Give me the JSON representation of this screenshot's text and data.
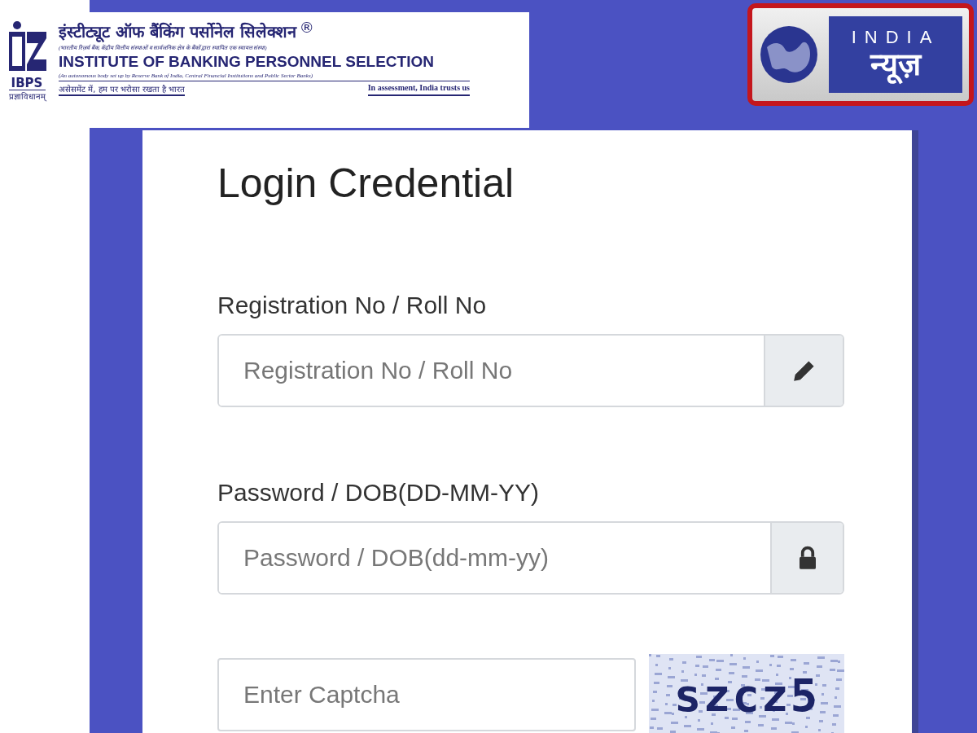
{
  "header": {
    "hindi_title": "इंस्टीट्यूट ऑफ बैंकिंग पर्सोनेल सिलेक्शन",
    "registered_mark": "®",
    "hindi_subtitle": "(भारतीय रिज़र्व बैंक, केंद्रीय वित्तीय संस्थाओं व सार्वजनिक क्षेत्र के बैंकों द्वारा स्थापित एक स्वायत्त संस्था)",
    "english_title": "INSTITUTE OF BANKING PERSONNEL SELECTION",
    "english_subtitle": "(An autonomous body set up by Reserve Bank of India, Central Financial Institutions and Public Sector Banks)",
    "hindi_tagline": "असेसमेंट में, हम पर भरोसा रखता है भारत",
    "english_tagline": "In assessment, India trusts us",
    "logo_text": "IBPS",
    "logo_motto": "प्रज्ञाविधानम्"
  },
  "channel_logo": {
    "word": "INDIA",
    "hindi_word": "न्यूज़"
  },
  "form": {
    "title": "Login Credential",
    "fields": [
      {
        "label": "Registration No / Roll No",
        "placeholder": "Registration No / Roll No",
        "kind": "pencil"
      },
      {
        "label": "Password / DOB(DD-MM-YY)",
        "placeholder": "Password / DOB(dd-mm-yy)",
        "kind": "lock"
      }
    ],
    "captcha": {
      "placeholder": "Enter Captcha",
      "code": "szcz5"
    }
  }
}
